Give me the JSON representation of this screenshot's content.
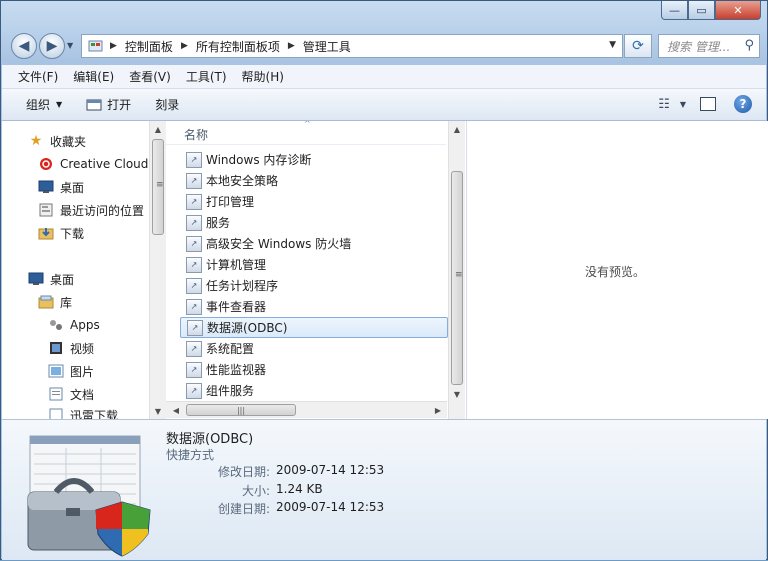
{
  "window": {
    "minimize_label": "—",
    "maximize_label": "▭",
    "close_label": "✕"
  },
  "nav": {
    "back_label": "◀",
    "forward_label": "▶",
    "breadcrumbs": [
      "控制面板",
      "所有控制面板项",
      "管理工具"
    ],
    "search_placeholder": "搜索 管理..."
  },
  "menubar": {
    "items": [
      "文件(F)",
      "编辑(E)",
      "查看(V)",
      "工具(T)",
      "帮助(H)"
    ]
  },
  "commandbar": {
    "organize_label": "组织",
    "open_label": "打开",
    "burn_label": "刻录"
  },
  "sidebar": {
    "favorites": {
      "header": "收藏夹",
      "items": [
        "Creative Cloud",
        "桌面",
        "最近访问的位置",
        "下载"
      ]
    },
    "desktop": {
      "header": "桌面",
      "library": "库",
      "library_items": [
        "Apps",
        "视频",
        "图片",
        "文档",
        "迅雷下载"
      ]
    }
  },
  "filelist": {
    "column_name": "名称",
    "items": [
      "Windows 内存诊断",
      "本地安全策略",
      "打印管理",
      "服务",
      "高级安全 Windows 防火墙",
      "计算机管理",
      "任务计划程序",
      "事件查看器",
      "数据源(ODBC)",
      "系统配置",
      "性能监视器",
      "组件服务"
    ],
    "selected_index": 8
  },
  "preview": {
    "message": "没有预览。"
  },
  "details": {
    "name": "数据源(ODBC)",
    "type": "快捷方式",
    "modified_label": "修改日期:",
    "modified_value": "2009-07-14 12:53",
    "size_label": "大小:",
    "size_value": "1.24 KB",
    "created_label": "创建日期:",
    "created_value": "2009-07-14 12:53"
  },
  "colors": {
    "selection_border": "#84acdd",
    "window_frame": "#b9d1ea",
    "accent": "#2e6bb0"
  }
}
